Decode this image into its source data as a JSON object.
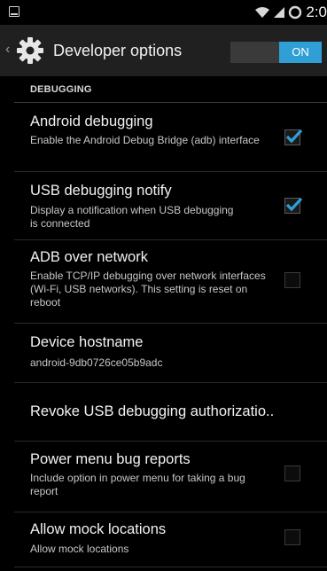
{
  "status_bar": {
    "time": "2:0"
  },
  "action_bar": {
    "title": "Developer options",
    "master_switch": "ON"
  },
  "section": {
    "header": "DEBUGGING"
  },
  "preferences": [
    {
      "title": "Android debugging",
      "summary": "Enable the Android Debug Bridge (adb) interface",
      "checked": true
    },
    {
      "title": "USB debugging notify",
      "summary": "Display a notification when USB debugging is connected",
      "checked": true
    },
    {
      "title": "ADB over network",
      "summary": "Enable TCP/IP debugging over network interfaces (Wi-Fi, USB networks). This setting is reset on reboot",
      "checked": false
    },
    {
      "title": "Device hostname",
      "summary": "android-9db0726ce05b9adc"
    },
    {
      "title": "Revoke USB debugging authorizatio.."
    },
    {
      "title": "Power menu bug reports",
      "summary": "Include option in power menu for taking a bug report",
      "checked": false
    },
    {
      "title": "Allow mock locations",
      "summary": "Allow mock locations",
      "checked": false
    }
  ],
  "colors": {
    "accent": "#2f9fd6",
    "background": "#000000",
    "action_bar": "#202020"
  }
}
